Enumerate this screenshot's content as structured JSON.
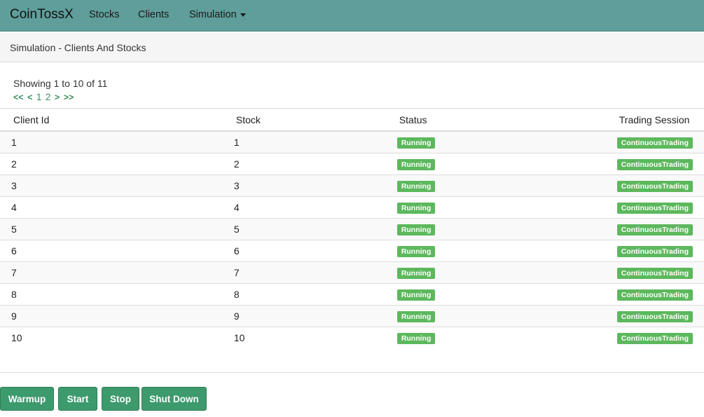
{
  "navbar": {
    "brand": "CoinTossX",
    "links": [
      "Stocks",
      "Clients",
      "Simulation"
    ]
  },
  "panel": {
    "title": "Simulation - Clients And Stocks"
  },
  "pagination": {
    "showing": "Showing 1 to 10 of 11",
    "first": "<<",
    "prev": "<",
    "pages": [
      "1",
      "2"
    ],
    "next": ">",
    "last": ">>"
  },
  "table": {
    "headers": [
      "Client Id",
      "Stock",
      "Status",
      "Trading Session"
    ],
    "rows": [
      {
        "client": "1",
        "stock": "1",
        "status": "Running",
        "session": "ContinuousTrading"
      },
      {
        "client": "2",
        "stock": "2",
        "status": "Running",
        "session": "ContinuousTrading"
      },
      {
        "client": "3",
        "stock": "3",
        "status": "Running",
        "session": "ContinuousTrading"
      },
      {
        "client": "4",
        "stock": "4",
        "status": "Running",
        "session": "ContinuousTrading"
      },
      {
        "client": "5",
        "stock": "5",
        "status": "Running",
        "session": "ContinuousTrading"
      },
      {
        "client": "6",
        "stock": "6",
        "status": "Running",
        "session": "ContinuousTrading"
      },
      {
        "client": "7",
        "stock": "7",
        "status": "Running",
        "session": "ContinuousTrading"
      },
      {
        "client": "8",
        "stock": "8",
        "status": "Running",
        "session": "ContinuousTrading"
      },
      {
        "client": "9",
        "stock": "9",
        "status": "Running",
        "session": "ContinuousTrading"
      },
      {
        "client": "10",
        "stock": "10",
        "status": "Running",
        "session": "ContinuousTrading"
      }
    ]
  },
  "buttons": {
    "warmup": "Warmup",
    "start": "Start",
    "stop": "Stop",
    "shutdown": "Shut Down"
  },
  "colors": {
    "navbar": "#5f9e9b",
    "badge": "#5cb85c",
    "button": "#3d9a6c",
    "link": "#3d8f5f"
  }
}
